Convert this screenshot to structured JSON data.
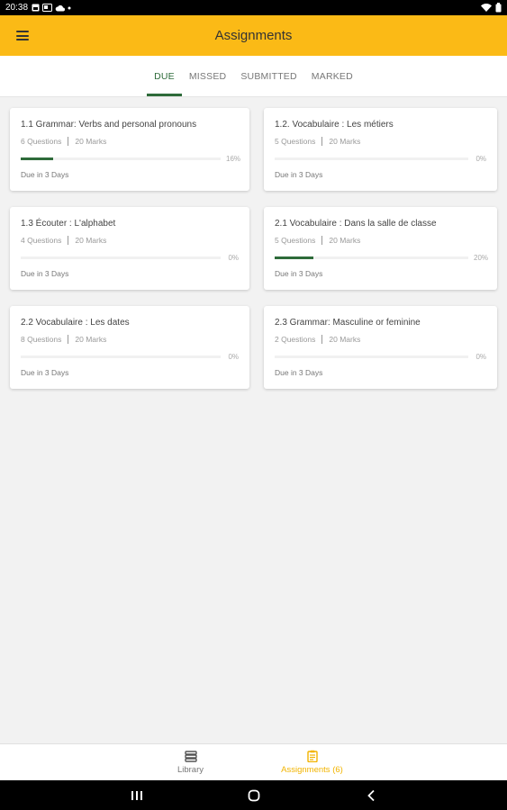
{
  "status_bar": {
    "time": "20:38"
  },
  "app_bar": {
    "title": "Assignments"
  },
  "tabs": [
    {
      "label": "DUE",
      "active": true
    },
    {
      "label": "MISSED",
      "active": false
    },
    {
      "label": "SUBMITTED",
      "active": false
    },
    {
      "label": "MARKED",
      "active": false
    }
  ],
  "cards": [
    {
      "title": "1.1 Grammar: Verbs and personal pronouns",
      "questions": "6 Questions",
      "marks": "20 Marks",
      "progress_label": "16%",
      "progress": 16,
      "due": "Due in 3 Days"
    },
    {
      "title": "1.2. Vocabulaire : Les métiers",
      "questions": "5 Questions",
      "marks": "20 Marks",
      "progress_label": "0%",
      "progress": 0,
      "due": "Due in 3 Days"
    },
    {
      "title": "1.3 Écouter : L'alphabet",
      "questions": "4 Questions",
      "marks": "20 Marks",
      "progress_label": "0%",
      "progress": 0,
      "due": "Due in 3 Days"
    },
    {
      "title": "2.1 Vocabulaire : Dans la salle de classe",
      "questions": "5 Questions",
      "marks": "20 Marks",
      "progress_label": "20%",
      "progress": 20,
      "due": "Due in 3 Days"
    },
    {
      "title": "2.2 Vocabulaire : Les dates",
      "questions": "8 Questions",
      "marks": "20 Marks",
      "progress_label": "0%",
      "progress": 0,
      "due": "Due in 3 Days"
    },
    {
      "title": "2.3 Grammar: Masculine or feminine",
      "questions": "2 Questions",
      "marks": "20 Marks",
      "progress_label": "0%",
      "progress": 0,
      "due": "Due in 3 Days"
    }
  ],
  "bottom_nav": {
    "library": {
      "label": "Library",
      "icon": "library-icon"
    },
    "assignments": {
      "label": "Assignments (6)",
      "icon": "clipboard-icon"
    }
  },
  "colors": {
    "accent": "#FBBA16",
    "progress": "#2E6B3A",
    "active_nav": "#F2B400"
  }
}
